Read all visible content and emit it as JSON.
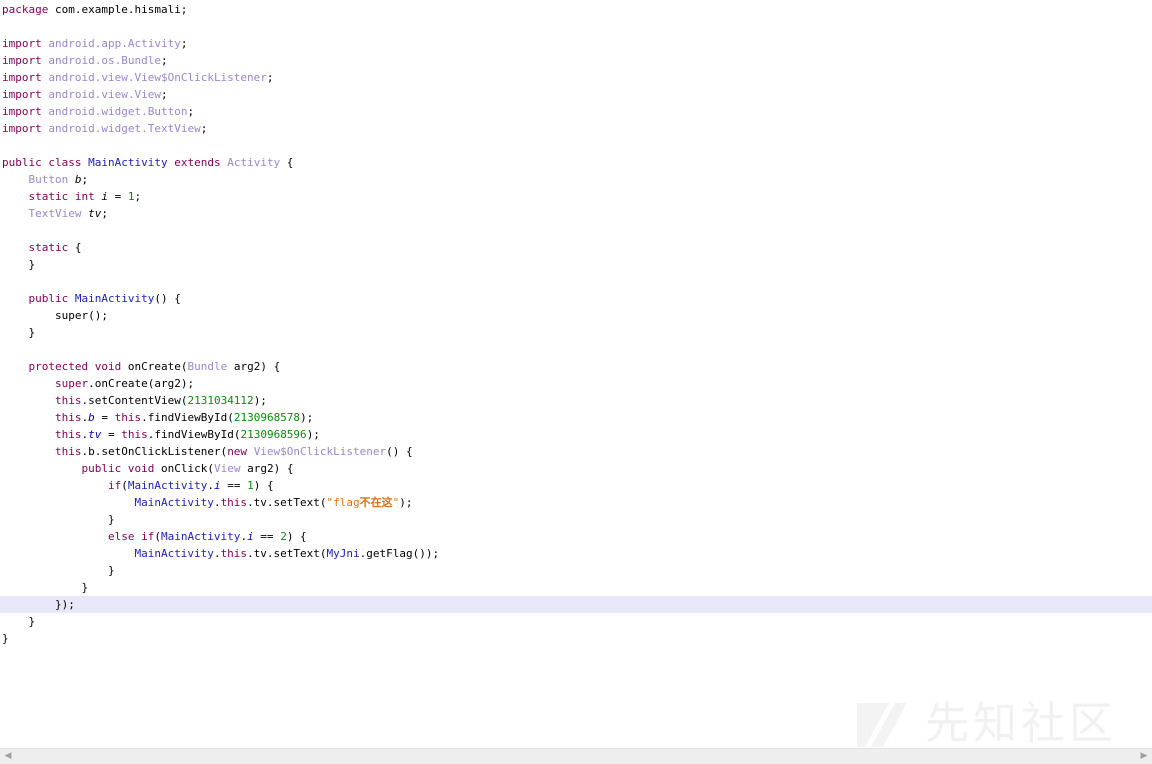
{
  "code": {
    "package_kw": "package",
    "package_name": " com.example.hismali;",
    "imports": [
      {
        "kw": "import",
        "path": "android.app.Activity"
      },
      {
        "kw": "import",
        "path": "android.os.Bundle"
      },
      {
        "kw": "import",
        "path": "android.view.View$OnClickListener"
      },
      {
        "kw": "import",
        "path": "android.view.View"
      },
      {
        "kw": "import",
        "path": "android.widget.Button"
      },
      {
        "kw": "import",
        "path": "android.widget.TextView"
      }
    ],
    "class_decl": {
      "mods": "public class",
      "name": "MainActivity",
      "extends_kw": "extends",
      "super": "Activity"
    },
    "fields": [
      {
        "type": "Button",
        "name": "b"
      },
      {
        "mods": "static int",
        "name": "i",
        "value": "1"
      },
      {
        "type": "TextView",
        "name": "tv"
      }
    ],
    "static_kw": "static",
    "ctor": {
      "mods": "public",
      "name": "MainActivity",
      "body": "super();"
    },
    "oncreate": {
      "mods": "protected void",
      "name": "onCreate",
      "param_type": "Bundle",
      "param": "arg2",
      "super_call": "super",
      "super_method": ".onCreate(arg2);",
      "this_kw": "this",
      "set_content_view": ".setContentView(",
      "layout_id": "2131034112",
      "find_view": ".findViewById(",
      "b_id": "2130968578",
      "tv_id": "2130968596",
      "set_listener": ".b.setOnClickListener(",
      "new_kw": "new",
      "listener_type": "View$OnClickListener",
      "onclick_mods": "public void",
      "onclick_name": "onClick",
      "onclick_param_type": "View",
      "if_kw": "if",
      "else_kw": "else if",
      "main_cls": "MainActivity",
      "i_field": "i",
      "cmp1": "1",
      "cmp2": "2",
      "set_text": ".tv.setText(",
      "flag_str_prefix": "\"flag",
      "flag_str_cn": "不在这",
      "flag_str_suffix": "\"",
      "jni_cls": "MyJni",
      "jni_call": ".getFlag());"
    }
  },
  "watermark": {
    "text": "先知社区"
  }
}
